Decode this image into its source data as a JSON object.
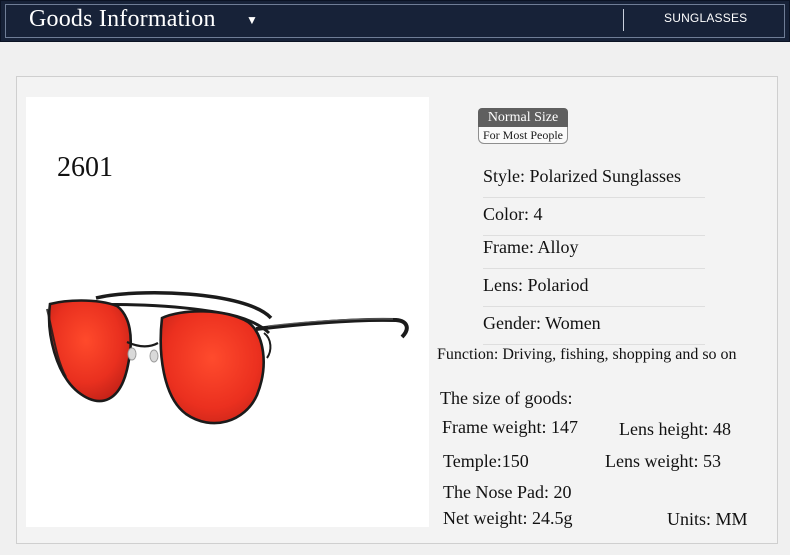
{
  "header": {
    "title": "Goods Information",
    "caret": "▼",
    "category": "SUNGLASSES"
  },
  "product": {
    "model": "2601",
    "badge_top": "Normal Size",
    "badge_bottom": "For Most People",
    "style": "Style: Polarized Sunglasses",
    "color": "Color:  4",
    "frame": "Frame: Alloy",
    "lens": "Lens: Polariod",
    "gender": "Gender: Women",
    "function": "Function: Driving, fishing, shopping and so on"
  },
  "sizes": {
    "title": "The size of goods:",
    "frame_weight": "Frame weight: 147",
    "lens_height": "Lens height: 48",
    "temple": "Temple:150",
    "lens_weight": "Lens weight: 53",
    "nose_pad": "The Nose Pad: 20",
    "net_weight": "Net weight: 24.5g",
    "units": "Units: MM"
  },
  "colors": {
    "header_bg": "#172238",
    "lens_red": "#e62d1f",
    "frame_black": "#1b1b1b"
  }
}
